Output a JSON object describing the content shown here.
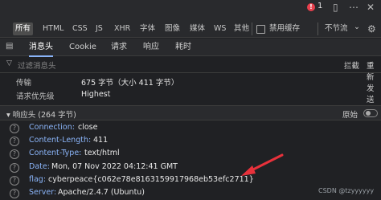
{
  "toolbar": {
    "error_count": "1",
    "filter_tabs": [
      "所有",
      "HTML",
      "CSS",
      "JS",
      "XHR",
      "字体",
      "图像",
      "媒体",
      "WS",
      "其他"
    ],
    "disable_cache": "禁用缓存",
    "throttle": "不节流",
    "throttle_arrow": "⌄"
  },
  "detail_tabs": [
    "消息头",
    "Cookie",
    "请求",
    "响应",
    "耗时"
  ],
  "filter": {
    "placeholder": "过滤消息头",
    "block": "拦截",
    "resend": "重新发送"
  },
  "transfer": {
    "label": "传输",
    "value": "675 字节（大小 411 字节）"
  },
  "priority": {
    "label": "请求优先级",
    "value": "Highest"
  },
  "response_section": {
    "title": "▾ 响应头 (264 字节)",
    "raw_label": "原始"
  },
  "response_headers": [
    {
      "name": "Connection:",
      "value": "close"
    },
    {
      "name": "Content-Length:",
      "value": "411"
    },
    {
      "name": "Content-Type:",
      "value": "text/html"
    },
    {
      "name": "Date:",
      "value": "Mon, 07 Nov 2022 04:12:41 GMT"
    },
    {
      "name": "flag:",
      "value": "cyberpeace{c062e78e8163159917968eb53efc2711}"
    },
    {
      "name": "Server:",
      "value": "Apache/2.4.7 (Ubuntu)"
    }
  ],
  "watermark": "CSDN @tzyyyyyy",
  "colors": {
    "background": "#202124",
    "header_name": "#8ab4f8",
    "arrow": "#e8313b"
  }
}
